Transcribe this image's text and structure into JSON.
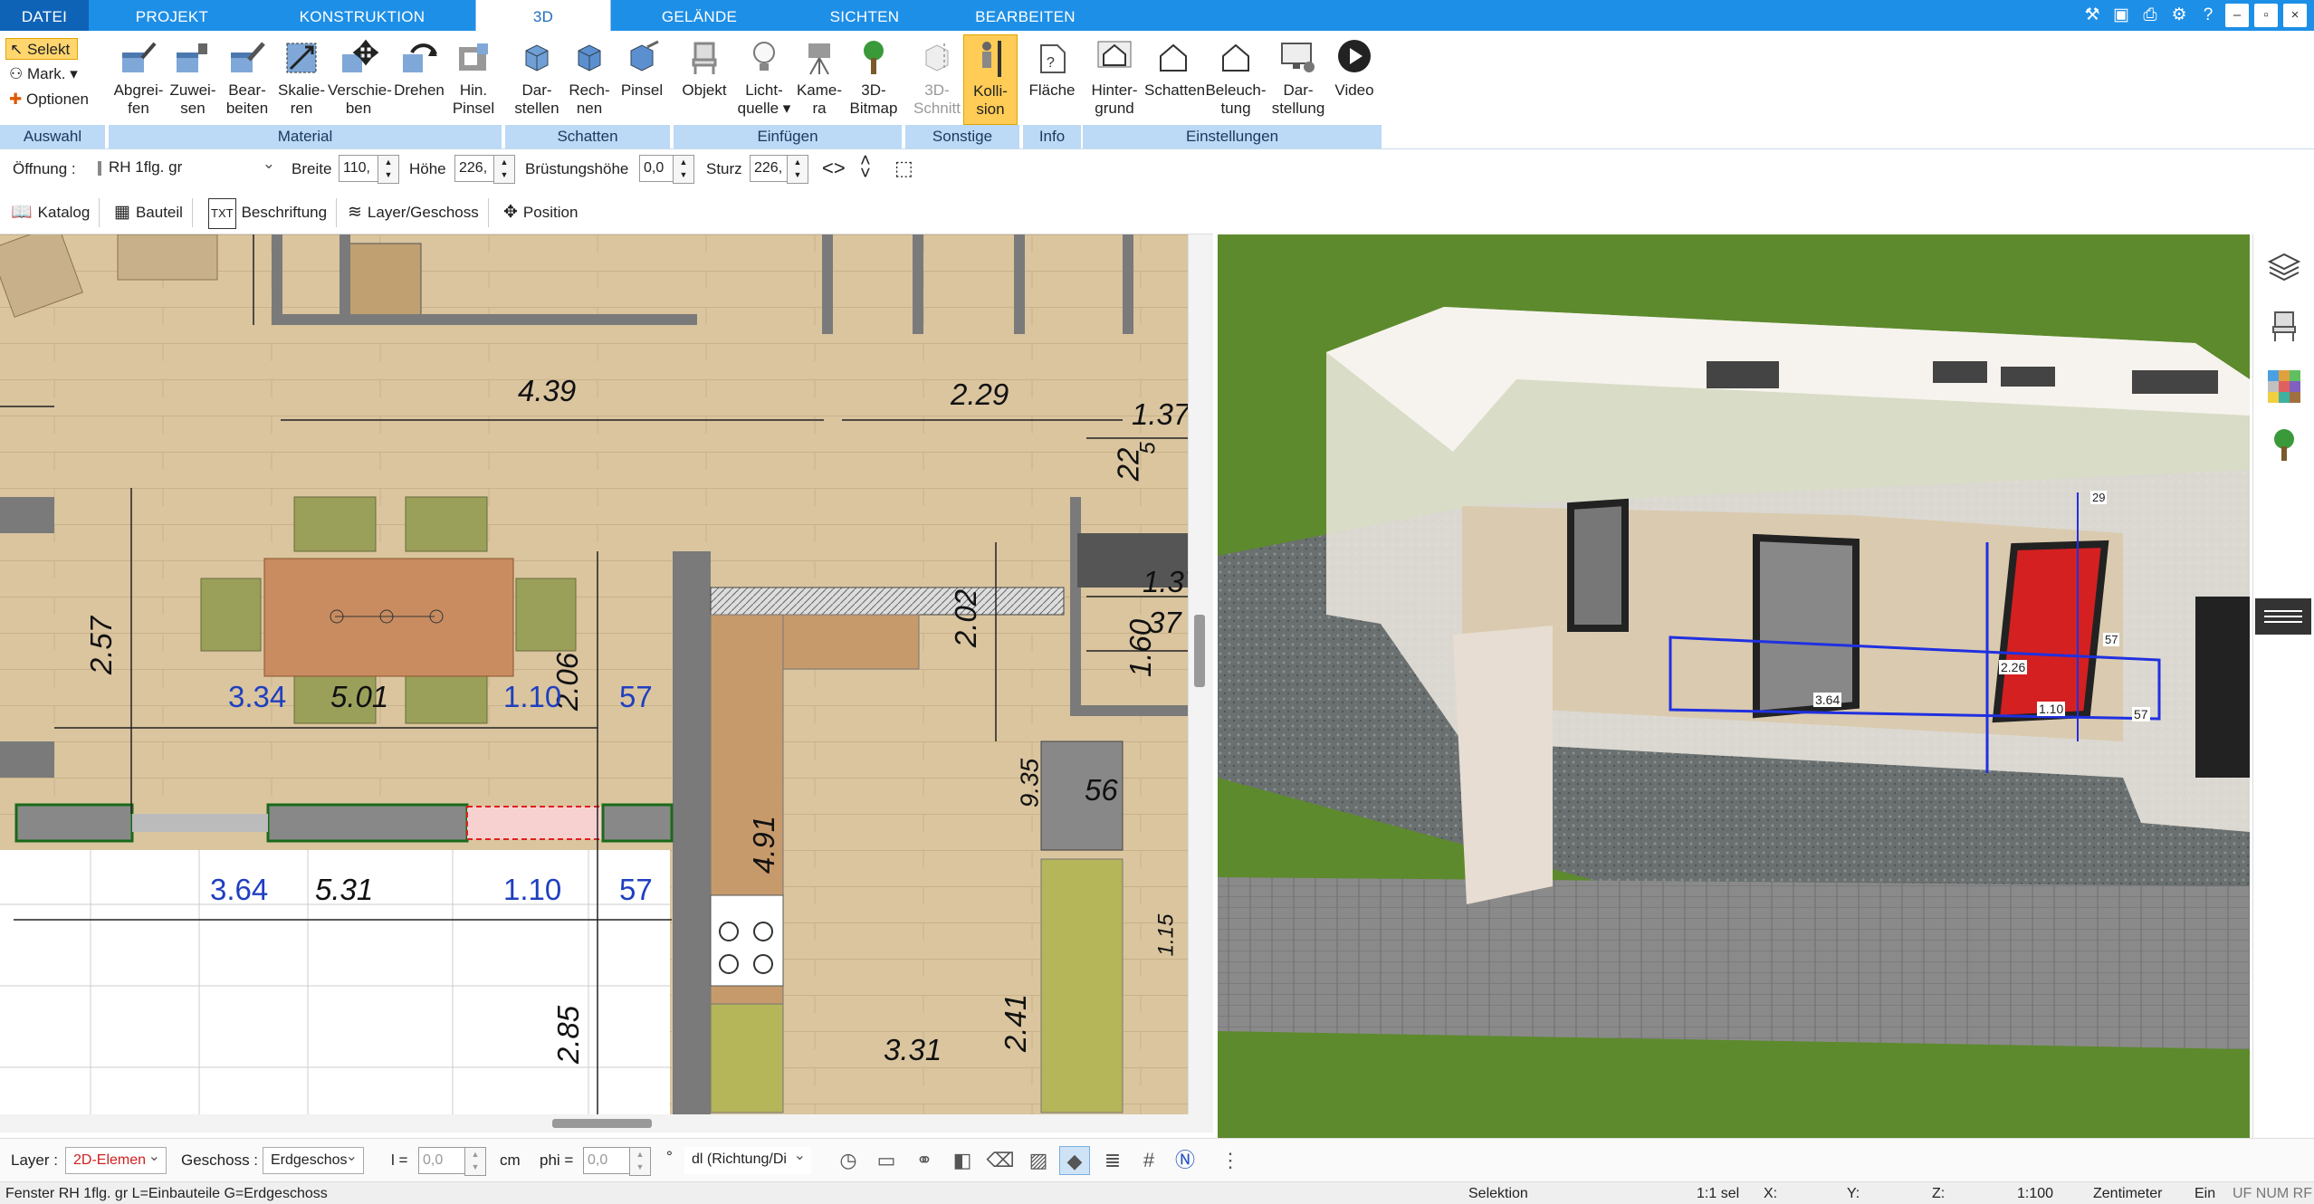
{
  "tabs": {
    "file": "DATEI",
    "projekt": "PROJEKT",
    "konstruktion": "KONSTRUKTION",
    "three_d": "3D",
    "gelaende": "GELÄNDE",
    "sichten": "SICHTEN",
    "bearbeiten": "BEARBEITEN"
  },
  "window": {
    "minimize": "–",
    "restore": "▫",
    "close": "×",
    "help": "?"
  },
  "auswahl": {
    "selekt": "Selekt",
    "mark": "Mark.",
    "optionen": "Optionen",
    "group": "Auswahl"
  },
  "material": {
    "group": "Material",
    "buttons": [
      {
        "l1": "Abgrei-",
        "l2": "fen"
      },
      {
        "l1": "Zuwei-",
        "l2": "sen"
      },
      {
        "l1": "Bear-",
        "l2": "beiten"
      },
      {
        "l1": "Skalie-",
        "l2": "ren"
      },
      {
        "l1": "Verschie-",
        "l2": "ben"
      },
      {
        "l1": "Drehen",
        "l2": ""
      },
      {
        "l1": "Hin.",
        "l2": "Pinsel"
      }
    ]
  },
  "schatten": {
    "group": "Schatten",
    "buttons": [
      {
        "l1": "Dar-",
        "l2": "stellen"
      },
      {
        "l1": "Rech-",
        "l2": "nen"
      },
      {
        "l1": "Pinsel",
        "l2": ""
      }
    ]
  },
  "einfuegen": {
    "group": "Einfügen",
    "buttons": [
      {
        "l1": "Objekt",
        "l2": ""
      },
      {
        "l1": "Licht-",
        "l2": "quelle ▾"
      },
      {
        "l1": "Kame-",
        "l2": "ra"
      },
      {
        "l1": "3D-",
        "l2": "Bitmap"
      }
    ]
  },
  "sonstige": {
    "group": "Sonstige",
    "buttons": [
      {
        "l1": "3D-",
        "l2": "Schnitt"
      },
      {
        "l1": "Kolli-",
        "l2": "sion"
      }
    ]
  },
  "info": {
    "group": "Info",
    "buttons": [
      {
        "l1": "Fläche",
        "l2": ""
      }
    ]
  },
  "einstellungen": {
    "group": "Einstellungen",
    "buttons": [
      {
        "l1": "Hinter-",
        "l2": "grund"
      },
      {
        "l1": "Schatten",
        "l2": ""
      },
      {
        "l1": "Beleuch-",
        "l2": "tung"
      },
      {
        "l1": "Dar-",
        "l2": "stellung"
      },
      {
        "l1": "Video",
        "l2": ""
      }
    ]
  },
  "options": {
    "oeffnung_label": "Öffnung :",
    "oeffnung_value": "RH 1flg. gr",
    "breite_label": "Breite",
    "breite_value": "110,",
    "hoehe_label": "Höhe",
    "hoehe_value": "226,",
    "bruestung_label": "Brüstungshöhe",
    "bruestung_value": "0,0",
    "sturz_label": "Sturz",
    "sturz_value": "226,"
  },
  "tools": {
    "katalog": "Katalog",
    "bauteil": "Bauteil",
    "beschriftung": "Beschriftung",
    "layer": "Layer/Geschoss",
    "position": "Position",
    "txt_icon": "TXT"
  },
  "plan": {
    "dims_black": [
      "4.39",
      "2.29",
      "1.37",
      "2.57",
      "5.01",
      "2.06",
      "2.02",
      "1.60",
      "37",
      "22",
      "5",
      "5.31",
      "4.91",
      "9.35",
      "56",
      "2.41",
      "3.31",
      "2.85",
      "1.37",
      "1.15"
    ],
    "dims_blue": [
      "3.34",
      "1.10",
      "57",
      "3.64",
      "1.10",
      "57"
    ]
  },
  "view3d": {
    "labels": [
      "3.64",
      "1.10",
      "57",
      "2.26",
      "29",
      "57"
    ]
  },
  "bottom": {
    "layer_label": "Layer :",
    "layer_value": "2D-Elemen",
    "geschoss_label": "Geschoss :",
    "geschoss_value": "Erdgeschos",
    "l_label": "l =",
    "l_value": "0,0",
    "l_unit": "cm",
    "phi_label": "phi =",
    "phi_value": "0,0",
    "phi_unit": "°",
    "dl_value": "dl (Richtung/Di"
  },
  "status": {
    "text": "Fenster RH 1flg. gr L=Einbauteile G=Erdgeschoss",
    "mode": "Selektion",
    "sel": "1:1 sel",
    "x": "X:",
    "y": "Y:",
    "z": "Z:",
    "scale": "1:100",
    "unit": "Zentimeter",
    "ein": "Ein",
    "flags": "UF NUM RF"
  }
}
